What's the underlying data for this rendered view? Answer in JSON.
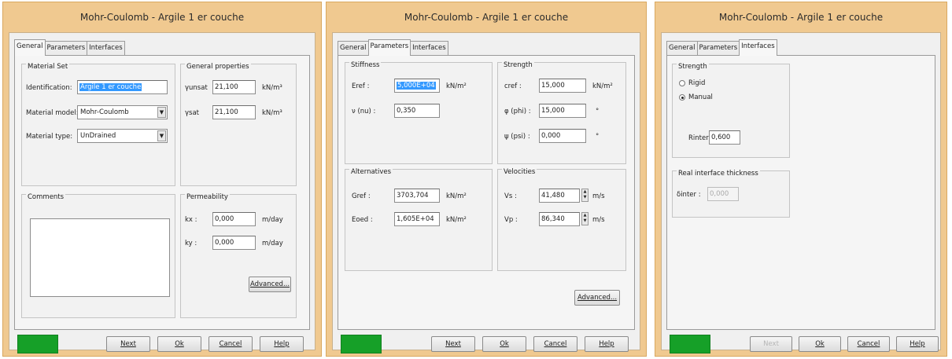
{
  "dialog_title": "Mohr-Coulomb - Argile 1 er couche",
  "tabs": {
    "general": "General",
    "parameters": "Parameters",
    "interfaces": "Interfaces"
  },
  "buttons": {
    "next": "Next",
    "ok": "Ok",
    "cancel": "Cancel",
    "help": "Help",
    "advanced": "Advanced..."
  },
  "status_color": "#16a028",
  "general": {
    "material_set": {
      "title": "Material Set",
      "identification_label": "Identification:",
      "identification_value": "Argile 1 er couche",
      "model_label": "Material model:",
      "model_value": "Mohr-Coulomb",
      "type_label": "Material type:",
      "type_value": "UnDrained"
    },
    "properties": {
      "title": "General properties",
      "gamma_unsat_label": "γunsat",
      "gamma_unsat_value": "21,100",
      "gamma_sat_label": "γsat",
      "gamma_sat_value": "21,100",
      "unit": "kN/m³"
    },
    "comments": {
      "title": "Comments",
      "value": ""
    },
    "permeability": {
      "title": "Permeability",
      "kx_label": "kx :",
      "kx_value": "0,000",
      "ky_label": "ky :",
      "ky_value": "0,000",
      "unit": "m/day"
    }
  },
  "parameters": {
    "stiffness": {
      "title": "Stiffness",
      "eref_label": "Eref :",
      "eref_value": "5,000E+04",
      "eref_unit": "kN/m²",
      "nu_label": "ν (nu) :",
      "nu_value": "0,350"
    },
    "strength": {
      "title": "Strength",
      "cref_label": "cref :",
      "cref_value": "15,000",
      "cref_unit": "kN/m²",
      "phi_label": "φ (phi) :",
      "phi_value": "15,000",
      "phi_unit": "°",
      "psi_label": "ψ (psi) :",
      "psi_value": "0,000",
      "psi_unit": "°"
    },
    "alternatives": {
      "title": "Alternatives",
      "gref_label": "Gref :",
      "gref_value": "3703,704",
      "gref_unit": "kN/m²",
      "eoed_label": "Eoed :",
      "eoed_value": "1,605E+04",
      "eoed_unit": "kN/m²"
    },
    "velocities": {
      "title": "Velocities",
      "vs_label": "Vs :",
      "vs_value": "41,480",
      "vp_label": "Vp :",
      "vp_value": "86,340",
      "unit": "m/s"
    }
  },
  "interfaces": {
    "strength": {
      "title": "Strength",
      "rigid_label": "Rigid",
      "manual_label": "Manual",
      "selected": "Manual",
      "rinter_label": "Rinter :",
      "rinter_value": "0,600"
    },
    "thickness": {
      "title": "Real interface thickness",
      "dinter_label": "δinter :",
      "dinter_value": "0,000"
    }
  }
}
